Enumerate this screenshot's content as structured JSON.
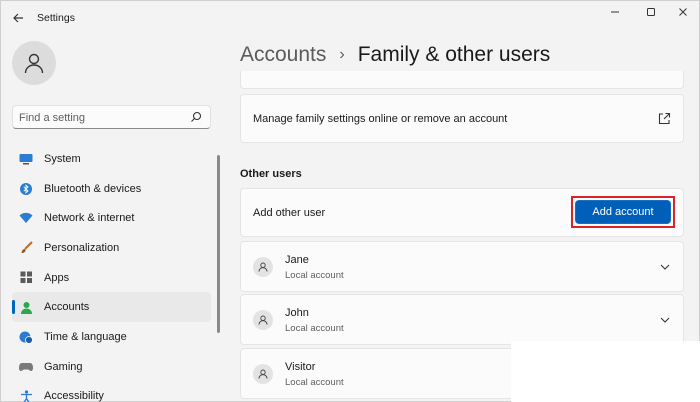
{
  "window": {
    "title": "Settings"
  },
  "search": {
    "placeholder": "Find a setting"
  },
  "sidebar": {
    "items": [
      {
        "label": "System",
        "icon": "monitor-icon"
      },
      {
        "label": "Bluetooth & devices",
        "icon": "bluetooth-icon"
      },
      {
        "label": "Network & internet",
        "icon": "wifi-icon"
      },
      {
        "label": "Personalization",
        "icon": "brush-icon"
      },
      {
        "label": "Apps",
        "icon": "apps-icon"
      },
      {
        "label": "Accounts",
        "icon": "person-icon",
        "active": true
      },
      {
        "label": "Time & language",
        "icon": "globe-clock-icon"
      },
      {
        "label": "Gaming",
        "icon": "gamepad-icon"
      },
      {
        "label": "Accessibility",
        "icon": "accessibility-icon"
      }
    ]
  },
  "breadcrumb": {
    "parent": "Accounts",
    "separator": "›",
    "current": "Family & other users"
  },
  "family": {
    "label": "Manage family settings online or remove an account"
  },
  "other_users": {
    "section_title": "Other users",
    "add_label": "Add other user",
    "add_button": "Add account",
    "users": [
      {
        "name": "Jane",
        "type": "Local account"
      },
      {
        "name": "John",
        "type": "Local account"
      },
      {
        "name": "Visitor",
        "type": "Local account"
      }
    ]
  },
  "colors": {
    "accent": "#005fb8",
    "highlight": "#d9232a",
    "background": "#f3f3f3",
    "card": "#fbfbfb"
  }
}
